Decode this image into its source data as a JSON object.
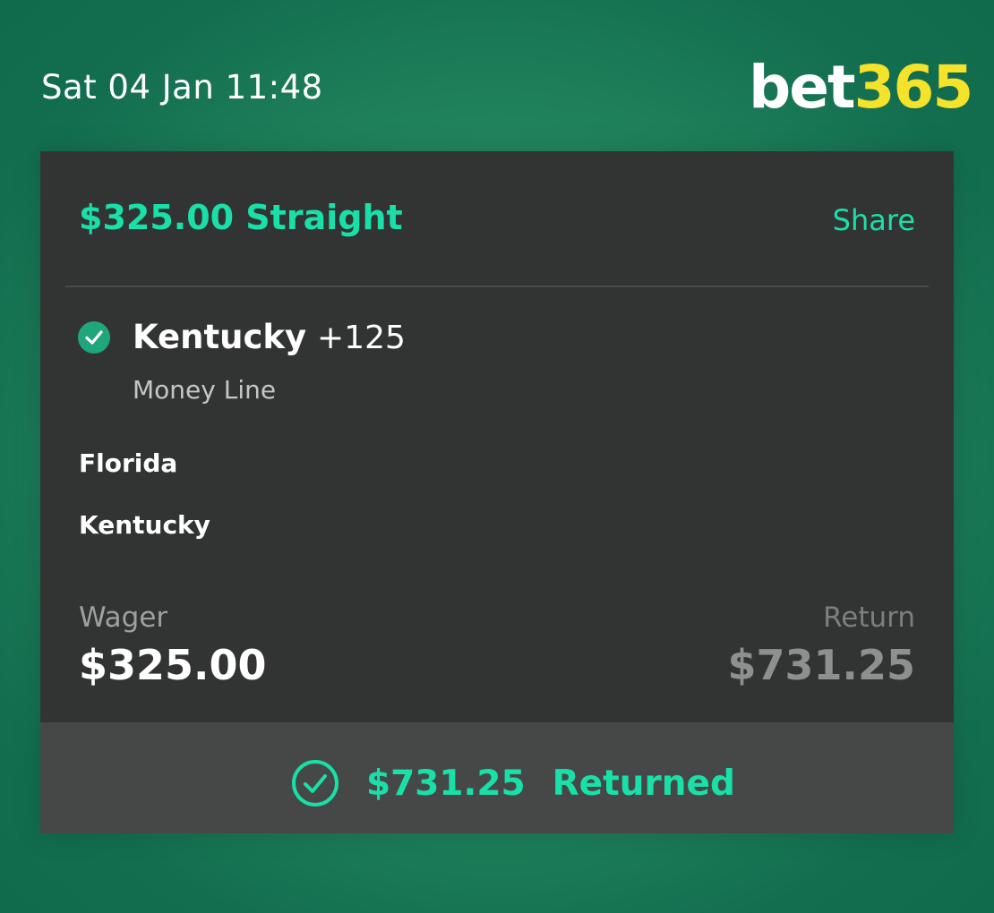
{
  "header": {
    "datetime": "Sat 04 Jan 11:48",
    "logo_main": "bet",
    "logo_num": "365"
  },
  "bet": {
    "title": "$325.00 Straight",
    "share_label": "Share",
    "selection": "Kentucky",
    "odds": "+125",
    "market": "Money Line",
    "team1": "Florida",
    "team2": "Kentucky",
    "wager_label": "Wager",
    "wager_value": "$325.00",
    "return_label": "Return",
    "return_value": "$731.25",
    "result_amount": "$731.25",
    "result_status": "Returned"
  },
  "icons": {
    "selection_check": "check-circle-icon",
    "footer_check": "check-circle-outline-icon"
  },
  "colors": {
    "background": "#1f7a57",
    "card": "#323433",
    "footer": "#464847",
    "accent": "#19e0a8",
    "logo_yellow": "#f5e22a",
    "check_fill": "#1fa67a"
  }
}
